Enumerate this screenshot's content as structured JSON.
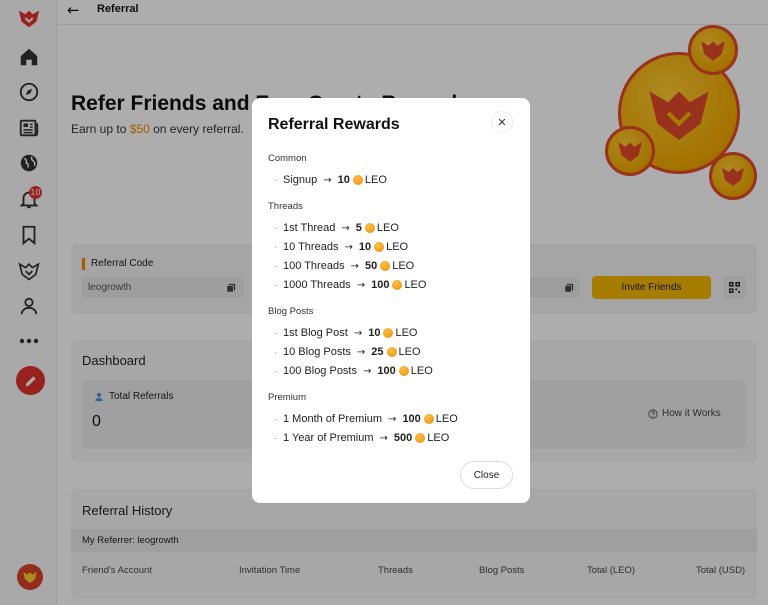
{
  "topbar": {
    "title": "Referral"
  },
  "sidebar": {
    "notification_count": "10"
  },
  "hero": {
    "title": "Refer Friends and Earn Crypto Rewards",
    "subtitle_pre": "Earn up to ",
    "subtitle_amount": "$50",
    "subtitle_post": " on every referral."
  },
  "referral_code": {
    "label": "Referral Code",
    "value": "leogrowth",
    "invite_label": "Invite Friends"
  },
  "dashboard": {
    "title": "Dashboard",
    "total_referrals_label": "Total Referrals",
    "total_referrals_value": "0",
    "how_it_works": "How it Works"
  },
  "history": {
    "title": "Referral History",
    "referrer": "My Referrer: leogrowth",
    "columns": [
      "Friend's Account",
      "Invitation Time",
      "Threads",
      "Blog Posts",
      "Total (LEO)",
      "Total (USD)"
    ]
  },
  "modal": {
    "title": "Referral Rewards",
    "close_label": "Close",
    "token": "LEO",
    "sections": [
      {
        "title": "Common",
        "rows": [
          {
            "label": "Signup",
            "value": "10"
          }
        ]
      },
      {
        "title": "Threads",
        "rows": [
          {
            "label": "1st Thread",
            "value": "5"
          },
          {
            "label": "10 Threads",
            "value": "10"
          },
          {
            "label": "100 Threads",
            "value": "50"
          },
          {
            "label": "1000 Threads",
            "value": "100"
          }
        ]
      },
      {
        "title": "Blog Posts",
        "rows": [
          {
            "label": "1st Blog Post",
            "value": "10"
          },
          {
            "label": "10 Blog Posts",
            "value": "25"
          },
          {
            "label": "100 Blog Posts",
            "value": "100"
          }
        ]
      },
      {
        "title": "Premium",
        "rows": [
          {
            "label": "1 Month of Premium",
            "value": "100"
          },
          {
            "label": "1 Year of Premium",
            "value": "500"
          }
        ]
      }
    ]
  },
  "colors": {
    "accent": "#f5b800",
    "brand_red": "#e0332b",
    "orange": "#f08a00"
  }
}
